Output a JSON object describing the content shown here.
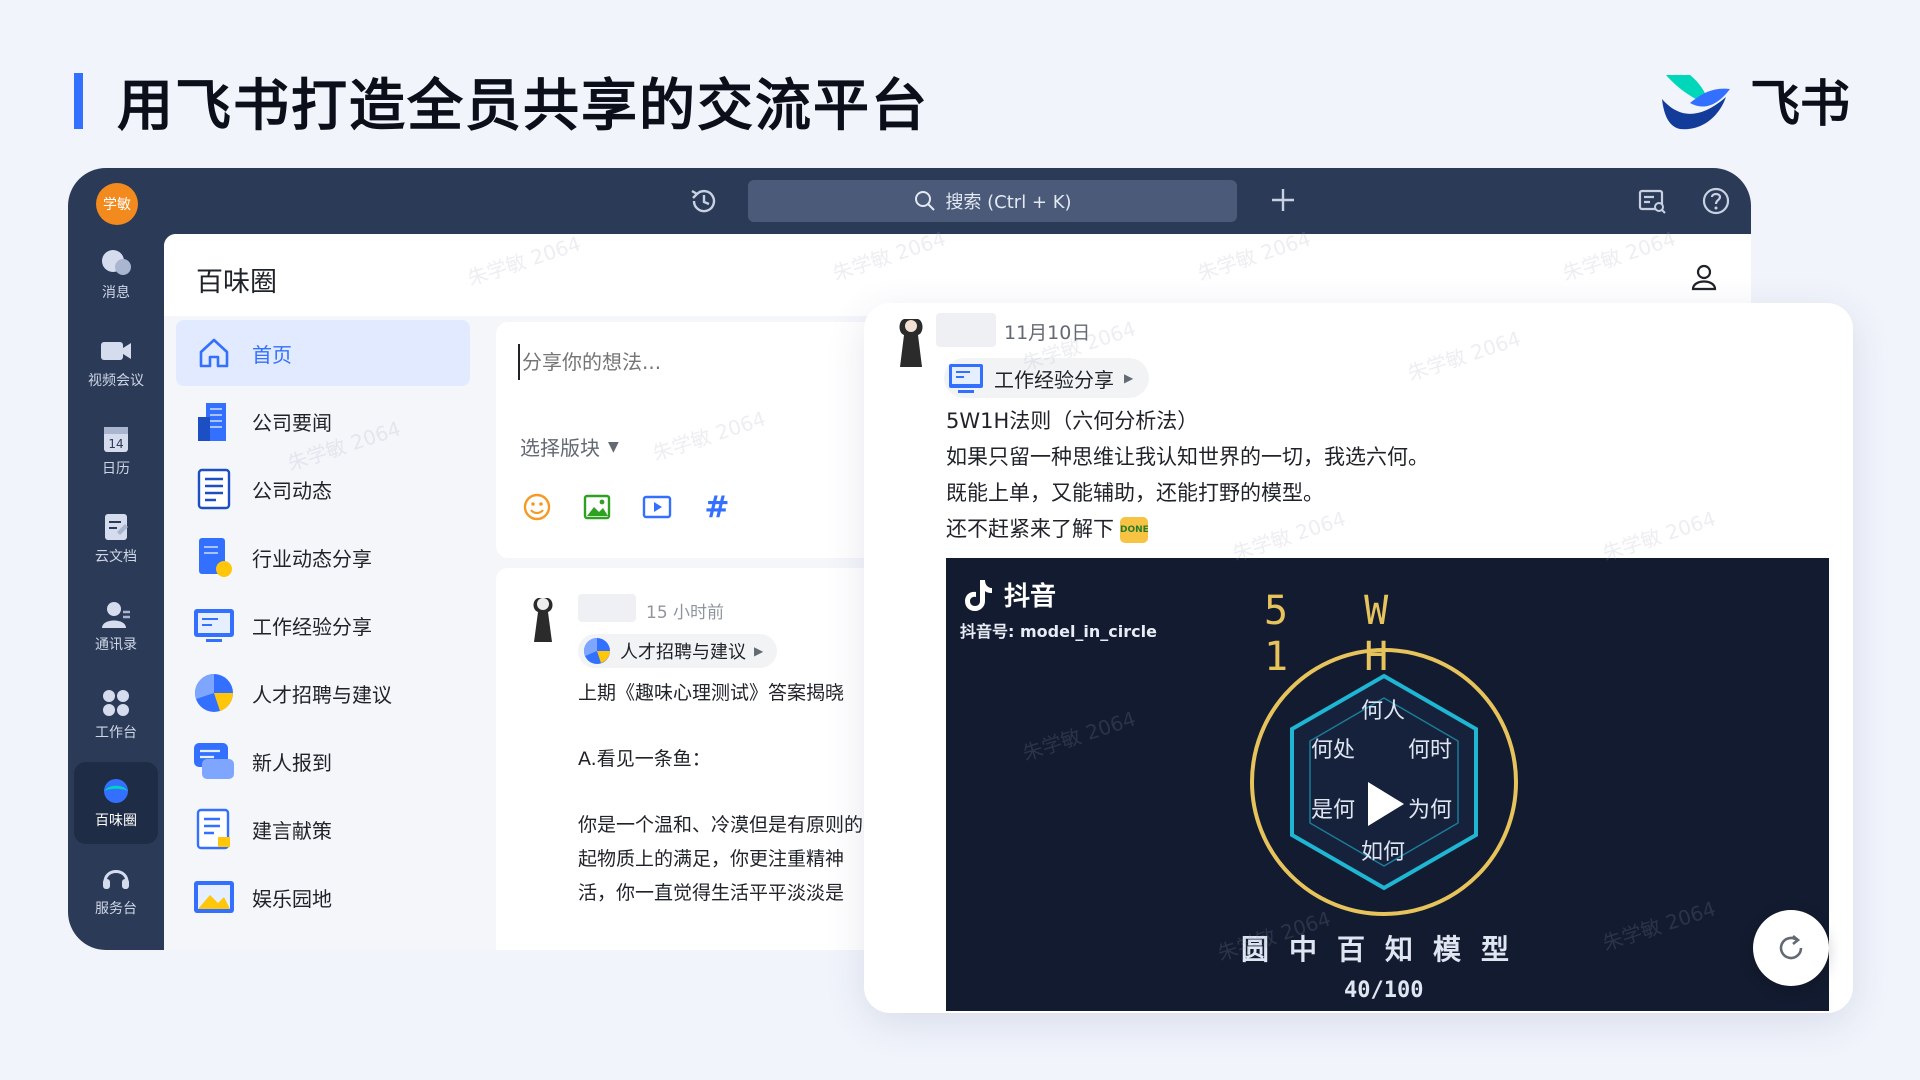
{
  "slide": {
    "title": "用飞书打造全员共享的交流平台",
    "brand_name": "飞书"
  },
  "topbar": {
    "avatar_text": "学敏",
    "search_placeholder": "搜索 (Ctrl + K)"
  },
  "sidenav": {
    "items": [
      {
        "label": "消息",
        "icon": "chat-icon"
      },
      {
        "label": "视频会议",
        "icon": "video-camera-icon"
      },
      {
        "label": "日历",
        "icon": "calendar-icon"
      },
      {
        "label": "云文档",
        "icon": "doc-icon"
      },
      {
        "label": "通讯录",
        "icon": "contacts-icon"
      },
      {
        "label": "工作台",
        "icon": "apps-grid-icon"
      },
      {
        "label": "百味圈",
        "icon": "moments-icon"
      },
      {
        "label": "服务台",
        "icon": "headset-icon"
      }
    ],
    "active_index": 6
  },
  "page": {
    "title": "百味圈"
  },
  "channels": [
    {
      "label": "首页",
      "icon": "home-icon"
    },
    {
      "label": "公司要闻",
      "icon": "building-icon"
    },
    {
      "label": "公司动态",
      "icon": "list-doc-icon"
    },
    {
      "label": "行业动态分享",
      "icon": "book-icon"
    },
    {
      "label": "工作经验分享",
      "icon": "monitor-icon"
    },
    {
      "label": "人才招聘与建议",
      "icon": "pie-icon"
    },
    {
      "label": "新人报到",
      "icon": "chat-bubble-icon"
    },
    {
      "label": "建言献策",
      "icon": "note-icon"
    },
    {
      "label": "娱乐园地",
      "icon": "image-icon"
    }
  ],
  "composer": {
    "placeholder": "分享你的想法...",
    "section_select": "选择版块",
    "tools": [
      "emoji-icon",
      "image-icon",
      "video-icon",
      "hashtag-icon"
    ],
    "hashtag": "#"
  },
  "feed_post": {
    "time": "15 小时前",
    "tag": "人才招聘与建议",
    "lines": [
      "上期《趣味心理测试》答案揭晓",
      "A.看见一条鱼：",
      "你是一个温和、冷漠但是有原则的人，",
      "起物质上的满足，你更注重精神",
      "活，你一直觉得生活平平淡淡是"
    ]
  },
  "zoom_card": {
    "date": "11月10日",
    "tag": "工作经验分享",
    "lines": [
      "5W1H法则（六何分析法）",
      "如果只留一种思维让我认知世界的一切，我选六何。",
      "既能上单，又能辅助，还能打野的模型。",
      "还不赶紧来了解下"
    ],
    "done_badge": "DONE",
    "video": {
      "platform": "抖音",
      "account": "抖音号: model_in_circle",
      "heading": "5 W 1 H",
      "labels": [
        "何人",
        "何处",
        "何时",
        "是何",
        "为何",
        "如何"
      ],
      "caption": "圆中百知模型",
      "count": "40/100"
    }
  },
  "watermark_text": "朱学敏 2064",
  "colors": {
    "accent": "#3370ff",
    "nav_bg": "#2b3a57",
    "video_bg": "#131b30",
    "gold": "#e7c35c",
    "cyan": "#1fb6d4"
  }
}
